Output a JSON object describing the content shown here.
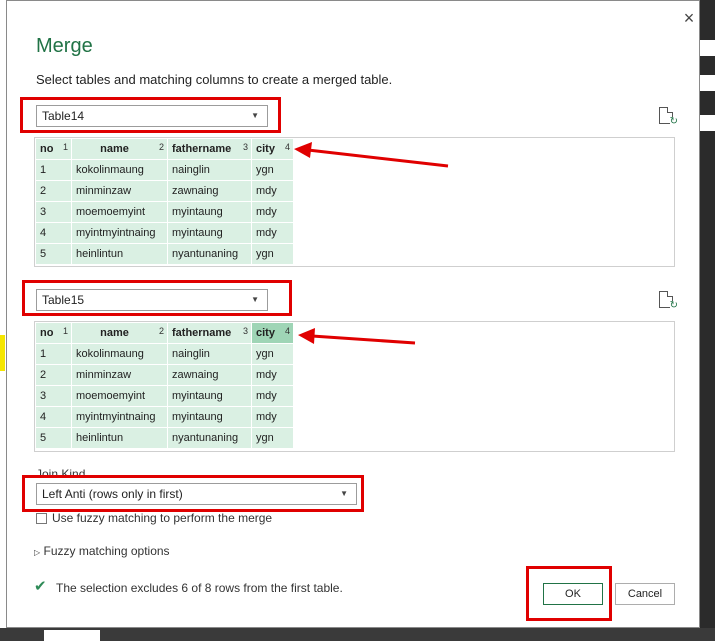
{
  "dialog": {
    "title": "Merge",
    "subtitle": "Select tables and matching columns to create a merged table.",
    "close_glyph": "×"
  },
  "table1": {
    "selected": "Table14",
    "columns": [
      {
        "name": "no",
        "index": "1"
      },
      {
        "name": "name",
        "index": "2"
      },
      {
        "name": "fathername",
        "index": "3"
      },
      {
        "name": "city",
        "index": "4"
      }
    ],
    "rows": [
      [
        "1",
        "kokolinmaung",
        "nainglin",
        "ygn"
      ],
      [
        "2",
        "minminzaw",
        "zawnaing",
        "mdy"
      ],
      [
        "3",
        "moemoemyint",
        "myintaung",
        "mdy"
      ],
      [
        "4",
        "myintmyintnaing",
        "myintaung",
        "mdy"
      ],
      [
        "5",
        "heinlintun",
        "nyantunaning",
        "ygn"
      ]
    ]
  },
  "table2": {
    "selected": "Table15",
    "columns": [
      {
        "name": "no",
        "index": "1"
      },
      {
        "name": "name",
        "index": "2"
      },
      {
        "name": "fathername",
        "index": "3"
      },
      {
        "name": "city",
        "index": "4"
      }
    ],
    "rows": [
      [
        "1",
        "kokolinmaung",
        "nainglin",
        "ygn"
      ],
      [
        "2",
        "minminzaw",
        "zawnaing",
        "mdy"
      ],
      [
        "3",
        "moemoemyint",
        "myintaung",
        "mdy"
      ],
      [
        "4",
        "myintmyintnaing",
        "myintaung",
        "mdy"
      ],
      [
        "5",
        "heinlintun",
        "nyantunaning",
        "ygn"
      ]
    ]
  },
  "join": {
    "label": "Join Kind",
    "selected": "Left Anti (rows only in first)",
    "fuzzy_checkbox_label": "Use fuzzy matching to perform the merge",
    "fuzzy_checked": false,
    "fuzzy_options_label": "Fuzzy matching options"
  },
  "status": {
    "text": "The selection excludes 6 of 8 rows from the first table."
  },
  "buttons": {
    "ok": "OK",
    "cancel": "Cancel"
  },
  "colors": {
    "accent": "#217346",
    "annotation": "#e00000",
    "table_cell": "#daf0e3",
    "selected_header": "#9fd5b6"
  }
}
